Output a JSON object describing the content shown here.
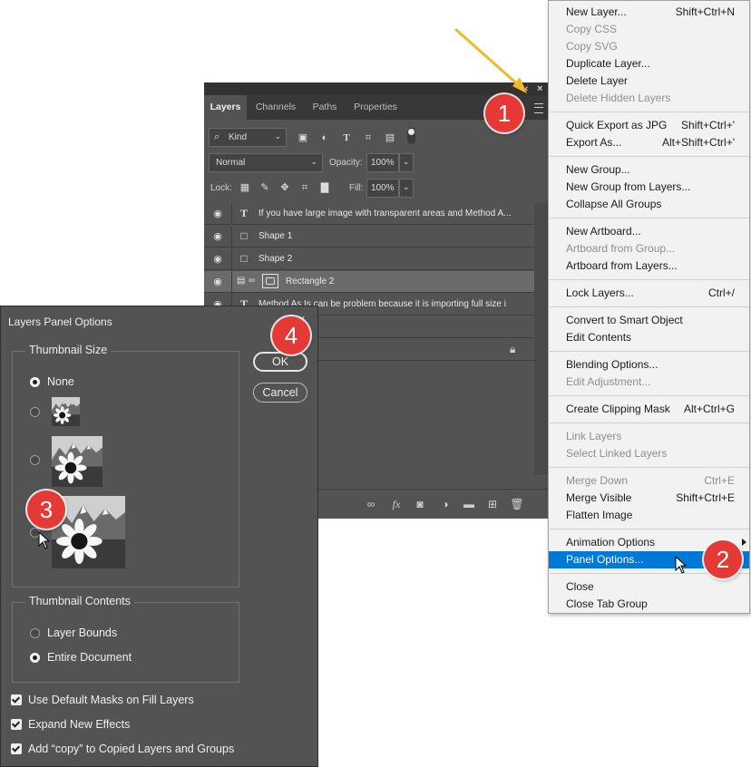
{
  "colors": {
    "panel_bg": "#535353",
    "menu_highlight": "#0078d7",
    "callout": "#e53935",
    "arrow": "#f2b92b"
  },
  "layers_panel": {
    "tabs": [
      "Layers",
      "Channels",
      "Paths",
      "Properties"
    ],
    "active_tab": "Layers",
    "filter_kind": "Kind",
    "blend_mode": "Normal",
    "opacity_label": "Opacity:",
    "opacity_value": "100%",
    "lock_label": "Lock:",
    "fill_label": "Fill:",
    "fill_value": "100%",
    "layers": [
      {
        "type_icon": "T",
        "name": "If you have large image with transparent areas and Method A..."
      },
      {
        "type_icon": "□",
        "name": "Shape 1"
      },
      {
        "type_icon": "□",
        "name": "Shape 2"
      },
      {
        "type_icon": "smart",
        "name": "Rectangle 2",
        "selected": true
      },
      {
        "type_icon": "T",
        "name": "Method As Is can be problem because it is importing full size i"
      }
    ]
  },
  "context_menu": {
    "groups": [
      [
        {
          "label": "New Layer...",
          "shortcut": "Shift+Ctrl+N"
        },
        {
          "label": "Copy CSS",
          "disabled": true
        },
        {
          "label": "Copy SVG",
          "disabled": true
        },
        {
          "label": "Duplicate Layer..."
        },
        {
          "label": "Delete Layer"
        },
        {
          "label": "Delete Hidden Layers",
          "disabled": true
        }
      ],
      [
        {
          "label": "Quick Export as JPG",
          "shortcut": "Shift+Ctrl+'"
        },
        {
          "label": "Export As...",
          "shortcut": "Alt+Shift+Ctrl+'"
        }
      ],
      [
        {
          "label": "New Group..."
        },
        {
          "label": "New Group from Layers..."
        },
        {
          "label": "Collapse All Groups"
        }
      ],
      [
        {
          "label": "New Artboard..."
        },
        {
          "label": "Artboard from Group...",
          "disabled": true
        },
        {
          "label": "Artboard from Layers..."
        }
      ],
      [
        {
          "label": "Lock Layers...",
          "shortcut": "Ctrl+/"
        }
      ],
      [
        {
          "label": "Convert to Smart Object"
        },
        {
          "label": "Edit Contents"
        }
      ],
      [
        {
          "label": "Blending Options..."
        },
        {
          "label": "Edit Adjustment...",
          "disabled": true
        }
      ],
      [
        {
          "label": "Create Clipping Mask",
          "shortcut": "Alt+Ctrl+G"
        }
      ],
      [
        {
          "label": "Link Layers",
          "disabled": true
        },
        {
          "label": "Select Linked Layers",
          "disabled": true
        }
      ],
      [
        {
          "label": "Merge Down",
          "shortcut": "Ctrl+E",
          "disabled": true
        },
        {
          "label": "Merge Visible",
          "shortcut": "Shift+Ctrl+E"
        },
        {
          "label": "Flatten Image"
        }
      ],
      [
        {
          "label": "Animation Options",
          "submenu": true
        },
        {
          "label": "Panel Options...",
          "highlighted": true
        }
      ],
      [
        {
          "label": "Close"
        },
        {
          "label": "Close Tab Group"
        }
      ]
    ]
  },
  "dialog": {
    "title": "Layers Panel Options",
    "close_glyph": "×",
    "thumbnail_size": {
      "legend": "Thumbnail Size",
      "none_label": "None",
      "selected": "None"
    },
    "thumbnail_contents": {
      "legend": "Thumbnail Contents",
      "options": [
        "Layer Bounds",
        "Entire Document"
      ],
      "selected": "Entire Document"
    },
    "checkboxes": [
      {
        "label": "Use Default Masks on Fill Layers",
        "checked": true
      },
      {
        "label": "Expand New Effects",
        "checked": true
      },
      {
        "label": "Add “copy” to Copied Layers and Groups",
        "checked": true
      }
    ],
    "ok_label": "OK",
    "cancel_label": "Cancel"
  },
  "callouts": [
    "1",
    "2",
    "3",
    "4"
  ]
}
